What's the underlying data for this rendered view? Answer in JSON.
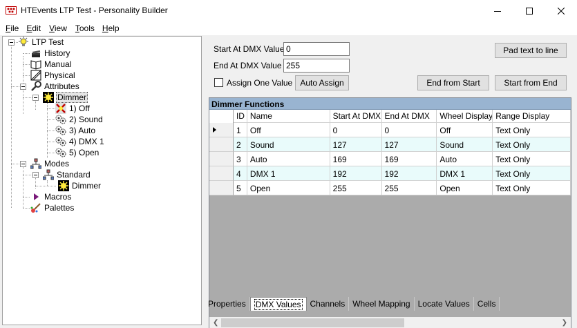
{
  "window": {
    "title": "HTEvents LTP Test - Personality Builder",
    "app_icon": "dmx-connector-icon",
    "controls": [
      "minimize-icon",
      "maximize-icon",
      "close-icon"
    ]
  },
  "menu": {
    "items": [
      {
        "label": "File",
        "mnemonic": "F",
        "rest": "ile"
      },
      {
        "label": "Edit",
        "mnemonic": "E",
        "rest": "dit"
      },
      {
        "label": "View",
        "mnemonic": "V",
        "rest": "iew"
      },
      {
        "label": "Tools",
        "mnemonic": "T",
        "rest": "ools"
      },
      {
        "label": "Help",
        "mnemonic": "H",
        "rest": "elp"
      }
    ]
  },
  "tree": {
    "root": "LTP Test",
    "history": "History",
    "manual": "Manual",
    "physical": "Physical",
    "attributes": "Attributes",
    "dimmer": "Dimmer",
    "functions": [
      "1) Off",
      "2) Sound",
      "3) Auto",
      "4) DMX 1",
      "5) Open"
    ],
    "modes": "Modes",
    "standard": "Standard",
    "mode_dimmer": "Dimmer",
    "macros": "Macros",
    "palettes": "Palettes"
  },
  "form": {
    "start_label": "Start At DMX Value",
    "start_value": "0",
    "end_label": "End At DMX Value",
    "end_value": "255",
    "assign_one_label": "Assign One Value",
    "assign_one_checked": false,
    "auto_assign": "Auto Assign",
    "pad_text": "Pad text to line",
    "end_from_start": "End from Start",
    "start_from_end": "Start from End"
  },
  "grid": {
    "caption": "Dimmer Functions",
    "columns": [
      "ID",
      "Name",
      "Start At DMX",
      "End At DMX",
      "Wheel Display",
      "Range Display"
    ],
    "rows": [
      [
        "1",
        "Off",
        "0",
        "0",
        "Off",
        "Text Only"
      ],
      [
        "2",
        "Sound",
        "127",
        "127",
        "Sound",
        "Text Only"
      ],
      [
        "3",
        "Auto",
        "169",
        "169",
        "Auto",
        "Text Only"
      ],
      [
        "4",
        "DMX 1",
        "192",
        "192",
        "DMX 1",
        "Text Only"
      ],
      [
        "5",
        "Open",
        "255",
        "255",
        "Open",
        "Text Only"
      ]
    ],
    "current_row": 0,
    "alt_row_color": "#e9fbfb"
  },
  "tabs": {
    "items": [
      "Properties",
      "DMX Values",
      "Channels",
      "Wheel Mapping",
      "Locate Values",
      "Cells"
    ],
    "active": 1
  }
}
